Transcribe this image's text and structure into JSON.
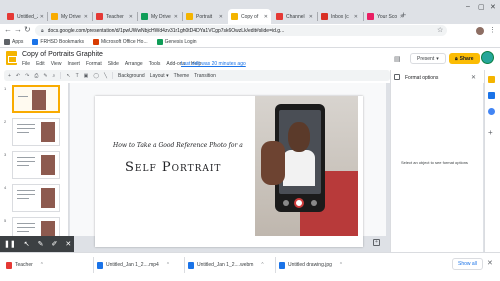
{
  "tabs": [
    {
      "label": "Untitled_Jan",
      "color": "#e53935",
      "active": false
    },
    {
      "label": "My Drive",
      "color": "#f9ab00",
      "active": false
    },
    {
      "label": "Teacher",
      "color": "#e53935",
      "active": false
    },
    {
      "label": "My Drive",
      "color": "#0f9d58",
      "active": false
    },
    {
      "label": "Portrait",
      "color": "#f4b400",
      "active": false
    },
    {
      "label": "Copy of",
      "color": "#f4b400",
      "active": true
    },
    {
      "label": "Channel",
      "color": "#e53935",
      "active": false
    },
    {
      "label": "Inbox (c",
      "color": "#d93025",
      "active": false
    },
    {
      "label": "Your Sco",
      "color": "#e91e63",
      "active": false
    }
  ],
  "address": {
    "url": "docs.google.com/presentation/d/1pwUWwNbjcHWd4zv31r1gh0tD4DYa1VCgp7sk6OwzLk/edit#slide=id.g..."
  },
  "bookmarks": [
    {
      "label": "Apps",
      "color": "#5f6368"
    },
    {
      "label": "FRHSD Bookmarks",
      "color": "#1a73e8"
    },
    {
      "label": "Microsoft Office Ho...",
      "color": "#d83b01"
    },
    {
      "label": "Genesis Login",
      "color": "#0f9d58"
    }
  ],
  "document": {
    "title": "Copy of Portraits Graphite",
    "menus": [
      "File",
      "Edit",
      "View",
      "Insert",
      "Format",
      "Slide",
      "Arrange",
      "Tools",
      "Add-ons",
      "Help"
    ],
    "last_edit": "Last edit was 20 minutes ago"
  },
  "header_buttons": {
    "present": "Present",
    "share": "Share"
  },
  "toolbar": {
    "background": "Background",
    "layout": "Layout ▾",
    "theme": "Theme",
    "transition": "Transition"
  },
  "slides": [
    {
      "number": "1",
      "selected": true
    },
    {
      "number": "2",
      "selected": false
    },
    {
      "number": "3",
      "selected": false
    },
    {
      "number": "4",
      "selected": false
    },
    {
      "number": "5",
      "selected": false
    }
  ],
  "slide_content": {
    "subtitle": "How to Take a Good Reference Photo for a",
    "title": "Self Portrait"
  },
  "format_panel": {
    "title": "Format options",
    "hint": "Select an object to see format options"
  },
  "downloads": [
    {
      "label": "Teacher",
      "color": "#e53935"
    },
    {
      "label": "Untitled_Jan 1_2....mp4",
      "color": "#1a73e8"
    },
    {
      "label": "Untitled_Jan 1_2....webm",
      "color": "#1a73e8"
    },
    {
      "label": "Untitled drawing.jpg",
      "color": "#1a73e8"
    }
  ],
  "show_all": "Show all",
  "accent_color": "#f4b400"
}
